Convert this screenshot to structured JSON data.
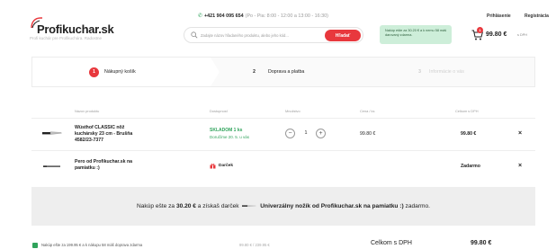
{
  "brand": {
    "name": "Profikuchar.sk",
    "tagline": "Profi kuchár pre Profikuchára. Radostne",
    "accent_color": "#e8383d",
    "success_color": "#2fa35b"
  },
  "header": {
    "phone": "+421 904 095 654",
    "hours": "(Po - Pia: 8:00 - 12:00 a 13:00 - 16:30)",
    "search_placeholder": "Zadajte názov hľadaného produktu, alebo jeho kód...",
    "search_button": "Hľadať",
    "promo_text": "Nakúp ešte za 30.20 € a k nemu 58 máš darovaný zdarma.",
    "login_label": "Prihlásenie",
    "register_label": "Registrácia",
    "cart_count": "1",
    "cart_total": "99.80 €",
    "cart_vat_note": "s DPH"
  },
  "steps": [
    {
      "number": "1",
      "label": "Nákupný košík"
    },
    {
      "number": "2",
      "label": "Doprava a platba"
    },
    {
      "number": "3",
      "label": "Informácie o vás"
    }
  ],
  "table": {
    "headers": {
      "product": "Názov produktu",
      "availability": "Dostupnosť",
      "quantity": "Množstvo",
      "unit_price": "Cena / ks",
      "total": "Celkom s DPH"
    },
    "rows": [
      {
        "name": "Wüsthof CLASSIC nôž kuchársky 23 cm - Brušňa 4582/23-7377",
        "stock": "SKLADOM 1 ks",
        "delivery": "Doručíme 20. 5. u vás",
        "quantity": "1",
        "unit_price": "99.80 €",
        "total": "99.80 €",
        "remove_icon": "×"
      },
      {
        "name": "Pero od Profikuchar.sk na pamiatku :)",
        "gift_label": "Darček",
        "total": "Zadarmo",
        "remove_icon": "×"
      }
    ]
  },
  "banner": {
    "prefix": "Nakúp ešte za",
    "amount": "30.20 €",
    "middle": "a získaš darček",
    "gift": "Univerzálny nožík od Profikuchar.sk na pamiatku :)",
    "suffix": "zadarmo."
  },
  "footer": {
    "note": "Nakúp ešte za 199.95 € a k nákupu 58 máš doprava zdarma",
    "mid": "99.80 € / 239.95 €",
    "total_label": "Celkom s DPH",
    "total_value": "99.80 €"
  }
}
